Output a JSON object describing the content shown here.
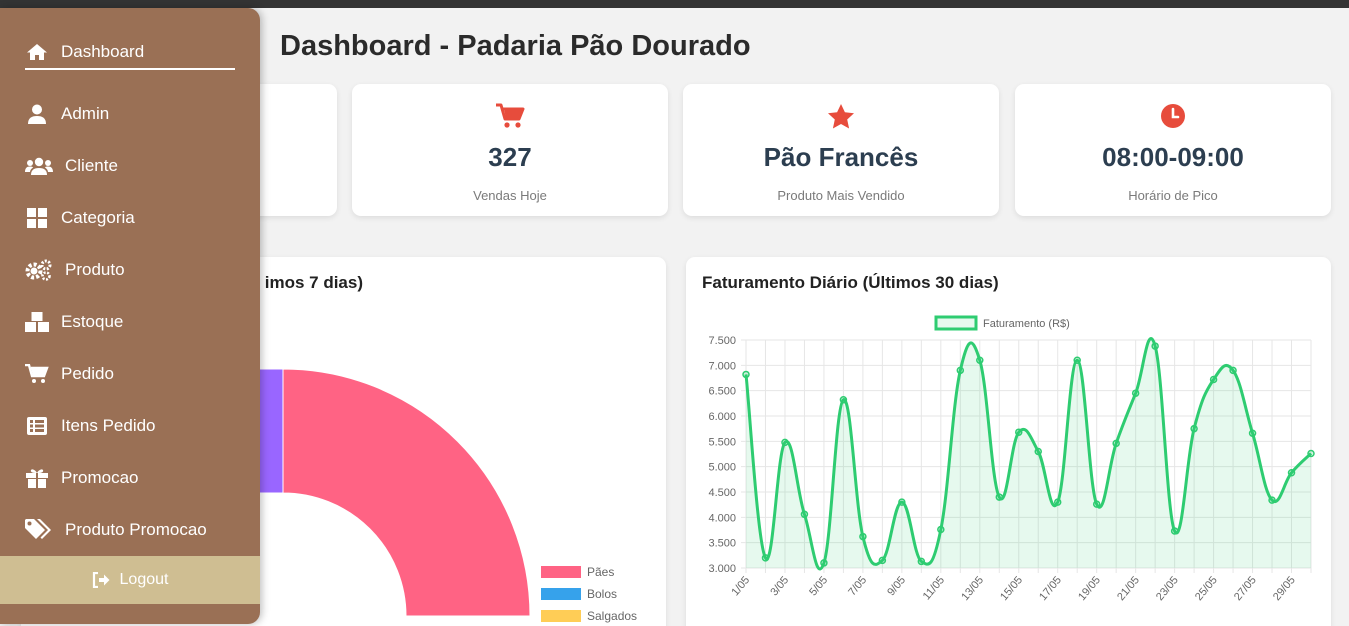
{
  "page": {
    "title": "Dashboard - Padaria Pão Dourado"
  },
  "sidebar": {
    "items": [
      {
        "label": "Dashboard",
        "icon": "home-icon",
        "active": true
      },
      {
        "label": "Admin",
        "icon": "user-icon"
      },
      {
        "label": "Cliente",
        "icon": "users-icon"
      },
      {
        "label": "Categoria",
        "icon": "grid-icon"
      },
      {
        "label": "Produto",
        "icon": "cogs-icon"
      },
      {
        "label": "Estoque",
        "icon": "boxes-icon"
      },
      {
        "label": "Pedido",
        "icon": "cart-icon"
      },
      {
        "label": "Itens Pedido",
        "icon": "list-icon"
      },
      {
        "label": "Promocao",
        "icon": "gift-icon"
      },
      {
        "label": "Produto Promocao",
        "icon": "tags-icon"
      }
    ],
    "logout_label": "Logout"
  },
  "cards": [
    {
      "value": "327",
      "label": "Vendas Hoje",
      "icon": "cart-icon"
    },
    {
      "value": "Pão Francês",
      "label": "Produto Mais Vendido",
      "icon": "star-icon"
    },
    {
      "value": "08:00-09:00",
      "label": "Horário de Pico",
      "icon": "clock-icon"
    }
  ],
  "colors": {
    "sidebar": "#9a7055",
    "logout": "#cfbe92",
    "accent_red": "#e74c3c",
    "line": "#2ecc71",
    "pie_paes": "#ff6384",
    "pie_bolos": "#36a2eb",
    "pie_salgados": "#ffcd56",
    "pie_purple": "#9966ff"
  },
  "chart_data": [
    {
      "type": "pie",
      "title": "imos 7 dias)",
      "legend": [
        "Pães",
        "Bolos",
        "Salgados"
      ],
      "legend_position": "right-bottom"
    },
    {
      "type": "line",
      "title": "Faturamento Diário (Últimos 30 dias)",
      "series": [
        {
          "name": "Faturamento (R$)",
          "values": [
            6820,
            3200,
            5480,
            4060,
            3100,
            6320,
            3620,
            3150,
            4300,
            3130,
            3760,
            6900,
            7100,
            4400,
            5680,
            5300,
            4300,
            7100,
            4260,
            5460,
            6450,
            7380,
            3730,
            5750,
            6720,
            6900,
            5660,
            4340,
            4880,
            5260
          ]
        }
      ],
      "x_tick_labels": [
        "1/05",
        "3/05",
        "5/05",
        "7/05",
        "9/05",
        "11/05",
        "13/05",
        "15/05",
        "17/05",
        "19/05",
        "21/05",
        "23/05",
        "25/05",
        "27/05",
        "29/05"
      ],
      "y_tick_labels": [
        "3.000",
        "3.500",
        "4.000",
        "4.500",
        "5.000",
        "5.500",
        "6.000",
        "6.500",
        "7.000",
        "7.500"
      ],
      "ylim": [
        3000,
        7500
      ],
      "grid": true,
      "fill": true,
      "legend_position": "top"
    }
  ]
}
